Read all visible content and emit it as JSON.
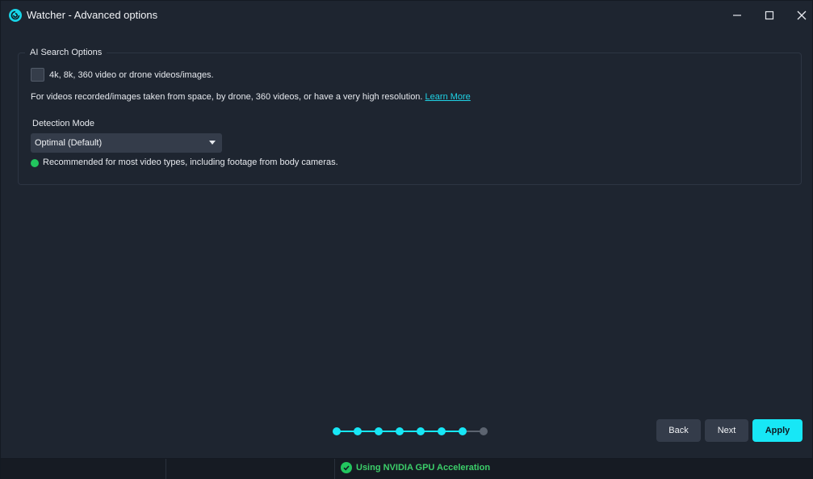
{
  "window": {
    "title": "Watcher - Advanced options",
    "logo_icon": "watcher-logo-icon",
    "controls": [
      "minimize-icon",
      "maximize-icon",
      "close-icon"
    ]
  },
  "ai_search": {
    "legend": "AI Search Options",
    "checkbox_label": "4k, 8k, 360 video or drone videos/images.",
    "checkbox_checked": false,
    "description": "For videos recorded/images taken from space, by drone, 360 videos, or have a very high resolution.",
    "learn_more": "Learn More",
    "detection_label": "Detection Mode",
    "detection_value": "Optimal (Default)",
    "recommendation": "Recommended for most video types, including footage from body cameras."
  },
  "steps": {
    "total": 8,
    "completed": 7,
    "active_color": "#17e7f6",
    "inactive_color": "#5c6470"
  },
  "buttons": {
    "back": "Back",
    "next": "Next",
    "apply": "Apply"
  },
  "status": {
    "gpu_text": "Using NVIDIA GPU Acceleration",
    "gpu_icon": "check-circle-icon",
    "color": "#22c55e"
  },
  "colors": {
    "accent": "#17e7f6",
    "background": "#1e2530",
    "link": "#1fd3e6"
  }
}
